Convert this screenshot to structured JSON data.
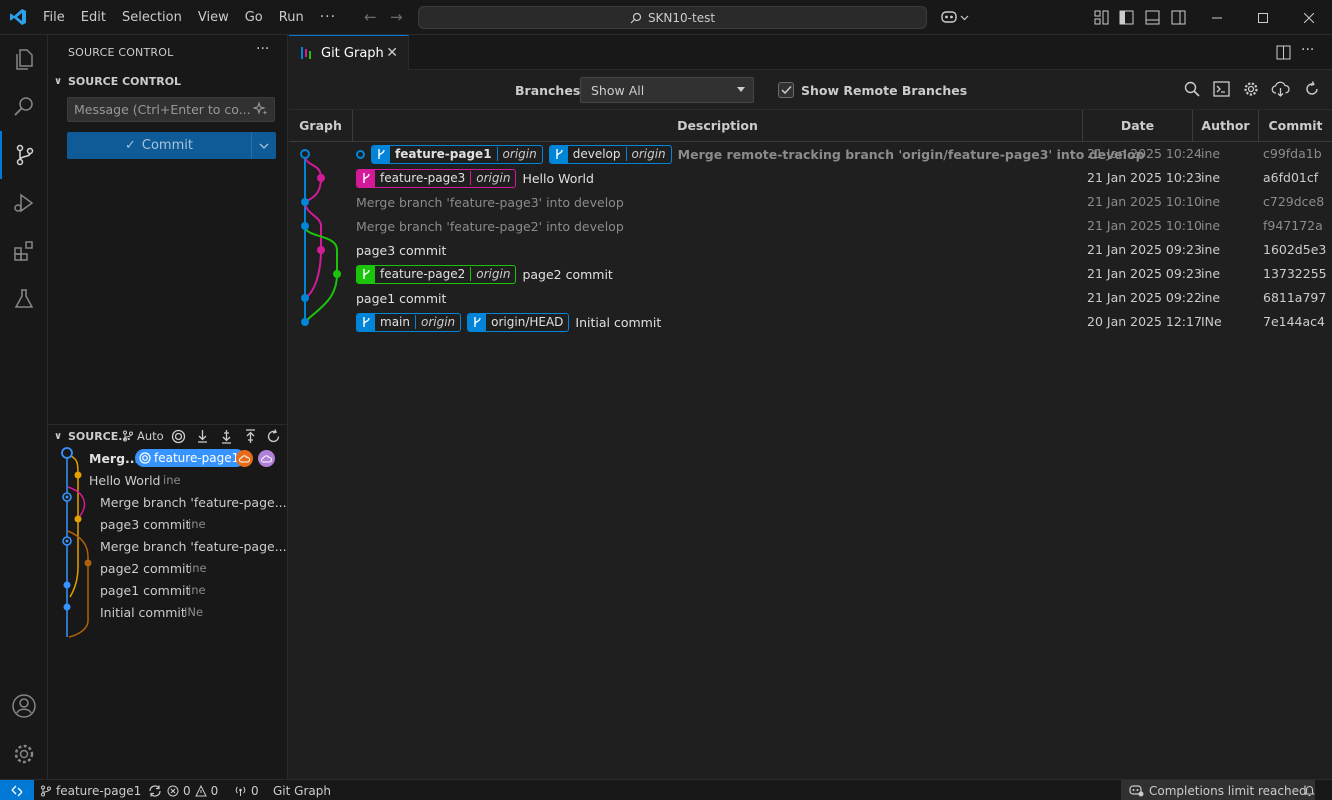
{
  "menu": [
    "File",
    "Edit",
    "Selection",
    "View",
    "Go",
    "Run"
  ],
  "menu_more": "···",
  "command_center": "SKN10-test",
  "sidebar": {
    "title": "SOURCE CONTROL",
    "more": "···",
    "section_title": "SOURCE CONTROL",
    "commit_placeholder": "Message (Ctrl+Enter to co...",
    "commit_label": "Commit",
    "graph_section_title": "SOURCE...",
    "auto_label": "Auto",
    "graph_rows": [
      {
        "message": "Merg...",
        "author": "",
        "ref": "feature-page1"
      },
      {
        "message": "Hello World",
        "author": "ine"
      },
      {
        "message": "Merge branch 'feature-page...",
        "author": ""
      },
      {
        "message": "page3 commit",
        "author": "ine"
      },
      {
        "message": "Merge branch 'feature-page...",
        "author": ""
      },
      {
        "message": "page2 commit",
        "author": "ine"
      },
      {
        "message": "page1 commit",
        "author": "ine"
      },
      {
        "message": "Initial commit",
        "author": "INe"
      }
    ]
  },
  "tab": {
    "label": "Git Graph",
    "close": "✕"
  },
  "gitgraph": {
    "branches_label": "Branches:",
    "branches_value": "Show All",
    "remote_label": "Show Remote Branches",
    "remote_checked": true,
    "headers": {
      "graph": "Graph",
      "description": "Description",
      "date": "Date",
      "author": "Author",
      "commit": "Commit"
    },
    "commits": [
      {
        "refs": [
          {
            "name": "feature-page1",
            "remote": "origin",
            "color": "#0085d9",
            "head": true
          },
          {
            "name": "develop",
            "remote": "origin",
            "color": "#0085d9"
          }
        ],
        "subject": "Merge remote-tracking branch 'origin/feature-page3' into develop",
        "date": "21 Jan 2025 10:24",
        "author": "ine",
        "hash": "c99fda1b"
      },
      {
        "refs": [
          {
            "name": "feature-page3",
            "remote": "origin",
            "color": "#d41a98"
          }
        ],
        "subject": "Hello World",
        "date": "21 Jan 2025 10:23",
        "author": "ine",
        "hash": "a6fd01cf"
      },
      {
        "refs": [],
        "subject": "Merge branch 'feature-page3' into develop",
        "date": "21 Jan 2025 10:10",
        "author": "ine",
        "hash": "c729dce8"
      },
      {
        "refs": [],
        "subject": "Merge branch 'feature-page2' into develop",
        "date": "21 Jan 2025 10:10",
        "author": "ine",
        "hash": "f947172a"
      },
      {
        "refs": [],
        "subject": "page3 commit",
        "date": "21 Jan 2025 09:23",
        "author": "ine",
        "hash": "1602d5e3"
      },
      {
        "refs": [
          {
            "name": "feature-page2",
            "remote": "origin",
            "color": "#1bc40a"
          }
        ],
        "subject": "page2 commit",
        "date": "21 Jan 2025 09:23",
        "author": "ine",
        "hash": "13732255"
      },
      {
        "refs": [],
        "subject": "page1 commit",
        "date": "21 Jan 2025 09:22",
        "author": "ine",
        "hash": "6811a797"
      },
      {
        "refs": [
          {
            "name": "main",
            "remote": "origin",
            "color": "#0085d9"
          },
          {
            "name": "origin/HEAD",
            "remote": "",
            "color": "#0085d9"
          }
        ],
        "subject": "Initial commit",
        "date": "20 Jan 2025 12:17",
        "author": "INe",
        "hash": "7e144ac4"
      }
    ]
  },
  "statusbar": {
    "branch": "feature-page1",
    "errors": "0",
    "warnings": "0",
    "ports": "0",
    "gitgraph": "Git Graph",
    "completions": "Completions limit reached"
  },
  "colors": {
    "accent": "#0078d4",
    "blue": "#0085d9",
    "magenta": "#d41a98",
    "green": "#1bc40a",
    "orange": "#e5a000"
  }
}
